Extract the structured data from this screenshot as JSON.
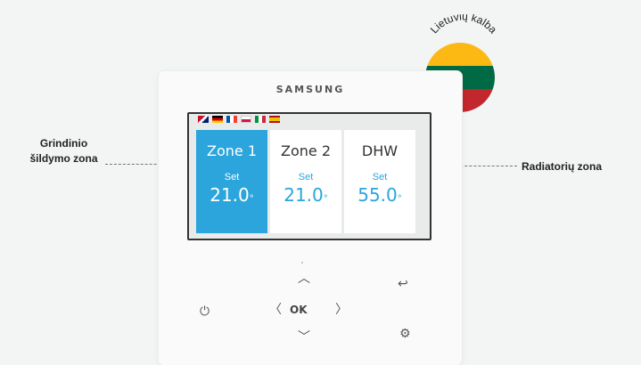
{
  "device": {
    "brand": "SAMSUNG",
    "flags": [
      "gb-flag",
      "de-flag",
      "fr-flag",
      "pl-flag",
      "it-flag",
      "es-flag"
    ],
    "zones": [
      {
        "name": "Zone 1",
        "set_label": "Set",
        "temp": "21.0",
        "unit": "°",
        "active": true
      },
      {
        "name": "Zone 2",
        "set_label": "Set",
        "temp": "21.0",
        "unit": "°",
        "active": false
      },
      {
        "name": "DHW",
        "set_label": "Set",
        "temp": "55.0",
        "unit": "°",
        "active": false
      }
    ],
    "buttons": {
      "ok_label": "OK",
      "up_icon": "chevron-up-icon",
      "down_icon": "chevron-down-icon",
      "left_icon": "chevron-left-icon",
      "right_icon": "chevron-right-icon",
      "power_icon": "power-icon",
      "back_icon": "back-arrow-icon",
      "settings_icon": "gear-icon"
    }
  },
  "callouts": {
    "left": "Grindinio šildymo zona",
    "right": "Radiatorių zona"
  },
  "language_badge": {
    "label": "Lietuvių kalba",
    "colors": [
      "#fdb913",
      "#006a44",
      "#c1272d"
    ]
  },
  "colors": {
    "accent": "#2ba5db",
    "background": "#f3f4f4"
  }
}
